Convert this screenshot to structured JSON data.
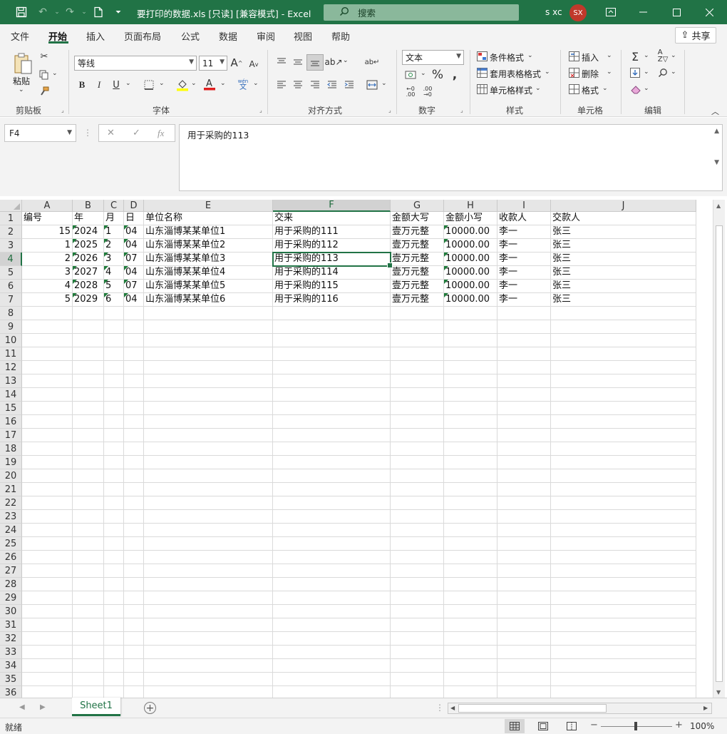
{
  "titlebar": {
    "title": "要打印的数据.xls  [只读]  [兼容模式]  -  Excel",
    "search_placeholder": "搜索",
    "user_name": "s xc",
    "user_initials": "SX",
    "accent_color": "#217346"
  },
  "menu": {
    "tabs": [
      "文件",
      "开始",
      "插入",
      "页面布局",
      "公式",
      "数据",
      "审阅",
      "视图",
      "帮助"
    ],
    "active_tab": "开始",
    "share_label": "共享"
  },
  "ribbon": {
    "clipboard": {
      "paste_label": "粘贴",
      "group_label": "剪贴板"
    },
    "font": {
      "font_name": "等线",
      "font_size": "11",
      "group_label": "字体",
      "wen_label": "wén",
      "wen_char": "文"
    },
    "alignment": {
      "group_label": "对齐方式"
    },
    "number": {
      "format": "文本",
      "group_label": "数字"
    },
    "styles": {
      "conditional": "条件格式",
      "table": "套用表格格式",
      "cell": "单元格样式",
      "group_label": "样式"
    },
    "cells": {
      "insert": "插入",
      "delete": "删除",
      "format": "格式",
      "group_label": "单元格"
    },
    "editing": {
      "group_label": "编辑"
    }
  },
  "formula_bar": {
    "name_box": "F4",
    "formula": "用于采购的113"
  },
  "sheet": {
    "columns": [
      "A",
      "B",
      "C",
      "D",
      "E",
      "F",
      "G",
      "H",
      "I",
      "J"
    ],
    "selected_column": "F",
    "selected_row": 4,
    "row_numbers": [
      "1",
      "2",
      "3",
      "4",
      "5",
      "6",
      "7",
      "8",
      "9",
      "10",
      "11",
      "12",
      "13",
      "14",
      "15",
      "16",
      "17",
      "18",
      "19",
      "20",
      "21",
      "22",
      "23",
      "24",
      "25",
      "26",
      "27",
      "28",
      "29",
      "30",
      "31",
      "32",
      "33",
      "34",
      "35",
      "36"
    ],
    "rows": [
      [
        "编号",
        "年",
        "月",
        "日",
        "单位名称",
        "交来",
        "金额大写",
        "金额小写",
        "收款人",
        "交款人"
      ],
      [
        "15",
        "2024",
        "1",
        "04",
        "山东淄博某某单位1",
        "用于采购的111",
        "壹万元整",
        "10000.00",
        "李一",
        "张三"
      ],
      [
        "1",
        "2025",
        "2",
        "04",
        "山东淄博某某单位2",
        "用于采购的112",
        "壹万元整",
        "10000.00",
        "李一",
        "张三"
      ],
      [
        "2",
        "2026",
        "3",
        "07",
        "山东淄博某某单位3",
        "用于采购的113",
        "壹万元整",
        "10000.00",
        "李一",
        "张三"
      ],
      [
        "3",
        "2027",
        "4",
        "04",
        "山东淄博某某单位4",
        "用于采购的114",
        "壹万元整",
        "10000.00",
        "李一",
        "张三"
      ],
      [
        "4",
        "2028",
        "5",
        "07",
        "山东淄博某某单位5",
        "用于采购的115",
        "壹万元整",
        "10000.00",
        "李一",
        "张三"
      ],
      [
        "5",
        "2029",
        "6",
        "04",
        "山东淄博某某单位6",
        "用于采购的116",
        "壹万元整",
        "10000.00",
        "李一",
        "张三"
      ]
    ]
  },
  "sheet_tabs": {
    "tabs": [
      "Sheet1"
    ],
    "active": "Sheet1"
  },
  "status": {
    "text": "就绪",
    "zoom": "100%"
  }
}
